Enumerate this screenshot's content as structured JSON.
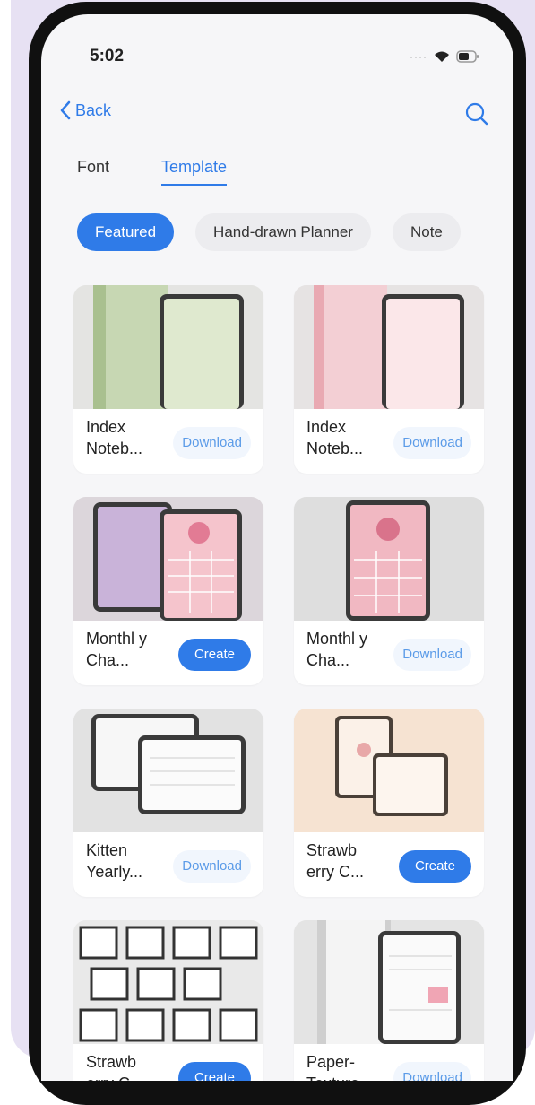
{
  "status": {
    "time": "5:02"
  },
  "nav": {
    "back_label": "Back"
  },
  "tabs": [
    {
      "label": "Font",
      "active": false
    },
    {
      "label": "Template",
      "active": true
    }
  ],
  "filters": [
    {
      "label": "Featured",
      "active": true
    },
    {
      "label": "Hand-drawn Planner",
      "active": false
    },
    {
      "label": "Note",
      "active": false
    }
  ],
  "templates": [
    {
      "name": "Index Noteb...",
      "action": "Download"
    },
    {
      "name": "Index Noteb...",
      "action": "Download"
    },
    {
      "name": "Monthl y Cha...",
      "action": "Create"
    },
    {
      "name": "Monthl y Cha...",
      "action": "Download"
    },
    {
      "name": "Kitten Yearly...",
      "action": "Download"
    },
    {
      "name": "Strawb erry C...",
      "action": "Create"
    },
    {
      "name": "Strawb erry C...",
      "action": "Create"
    },
    {
      "name": "Paper- Texture...",
      "action": "Download"
    }
  ],
  "colors": {
    "accent": "#2f7be8",
    "frame": "#101010",
    "backdrop": "#e7e1f3"
  }
}
